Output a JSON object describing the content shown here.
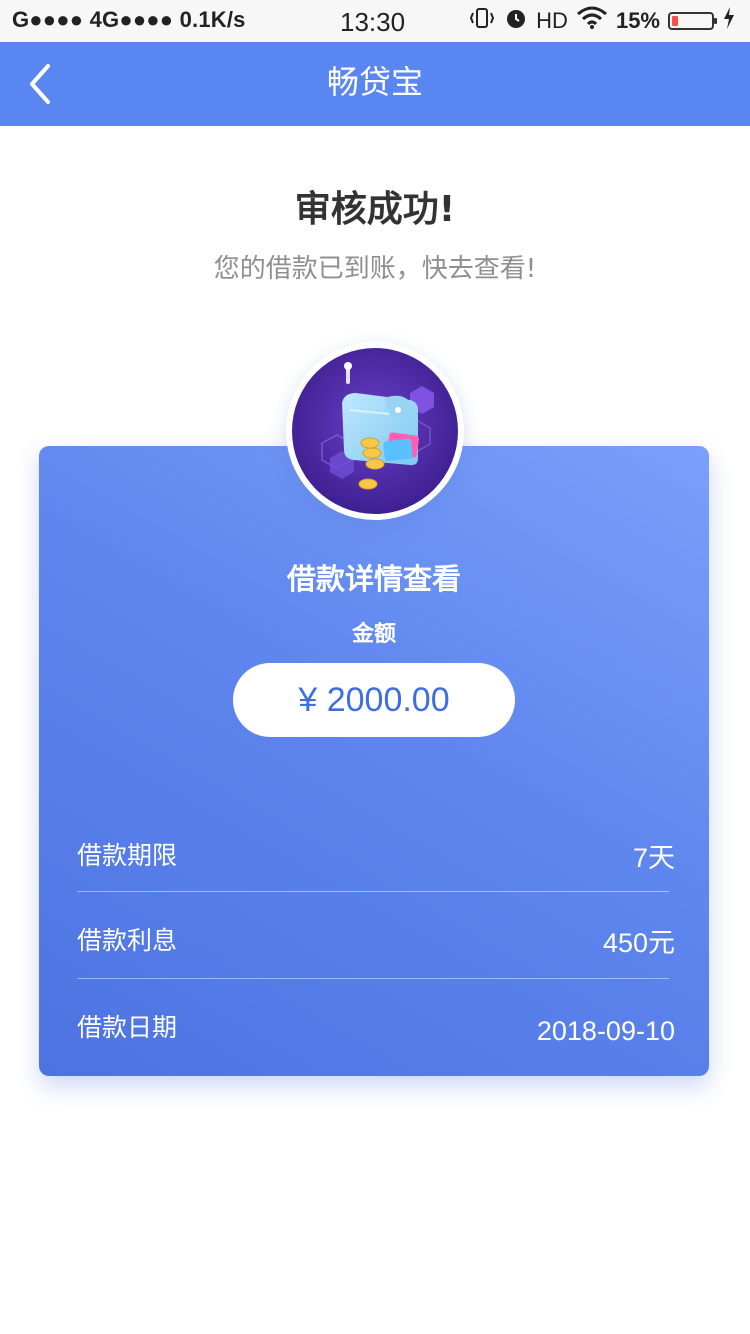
{
  "status_bar": {
    "left": "G●●●● 4G●●●● 0.1K/s",
    "time": "13:30",
    "hd": "HD",
    "battery_percent": "15%",
    "battery_level": 0.15
  },
  "header": {
    "title": "畅贷宝",
    "back_icon": "chevron-left-icon",
    "color": "#5a86f1"
  },
  "result": {
    "title": "审核成功!",
    "subtitle": "您的借款已到账，快去查看!"
  },
  "card": {
    "icon": "wallet-icon",
    "title": "借款详情查看",
    "amount_label": "金额",
    "amount": "¥ 2000.00",
    "rows": [
      {
        "label": "借款期限",
        "value": "7天"
      },
      {
        "label": "借款利息",
        "value": "450元"
      },
      {
        "label": "借款日期",
        "value": "2018-09-10"
      }
    ]
  }
}
